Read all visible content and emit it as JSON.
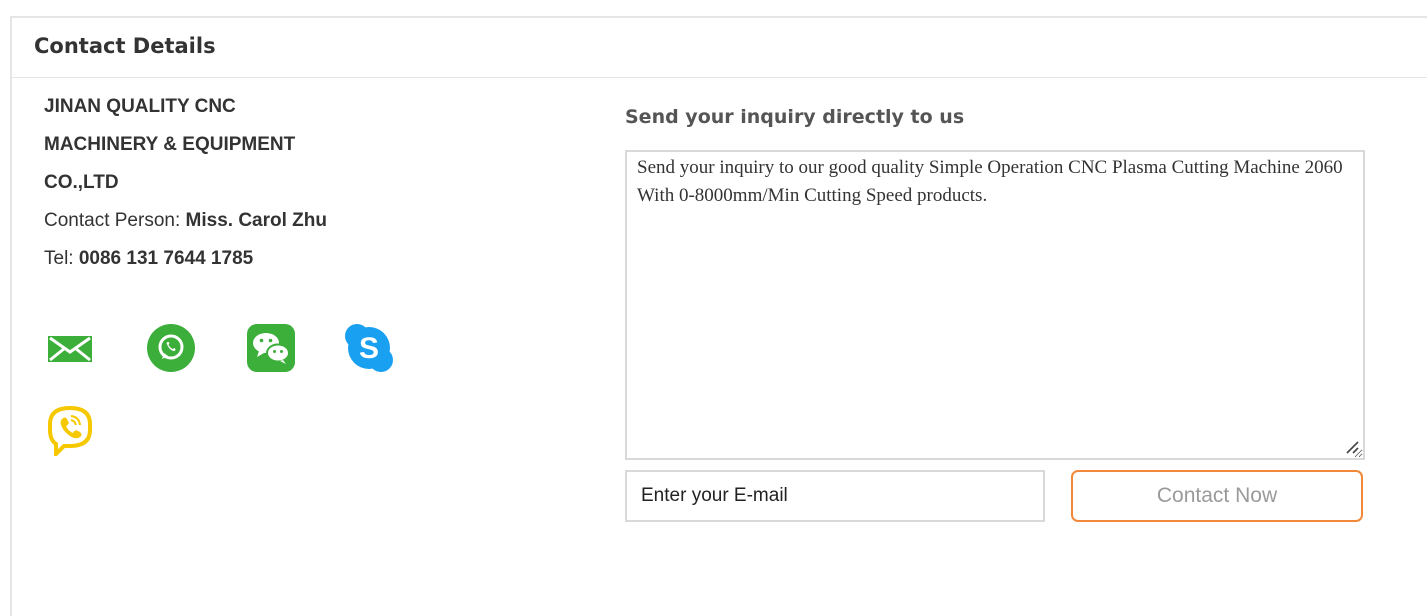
{
  "panel": {
    "title": "Contact Details"
  },
  "company": {
    "name_lines": [
      "JINAN QUALITY CNC",
      "MACHINERY & EQUIPMENT",
      "CO.,LTD"
    ],
    "contact_label": "Contact Person: ",
    "contact_name": "Miss. Carol Zhu",
    "tel_label": "Tel: ",
    "tel_value": "0086 131 7644 1785"
  },
  "icons": [
    {
      "name": "email-icon",
      "color": "#3cae3a"
    },
    {
      "name": "whatsapp-icon",
      "color": "#3cae3a"
    },
    {
      "name": "wechat-icon",
      "color": "#3cae3a"
    },
    {
      "name": "skype-icon",
      "color": "#1aa0f0"
    },
    {
      "name": "viber-icon",
      "color": "#f5c800"
    }
  ],
  "inquiry": {
    "title": "Send your inquiry directly to us",
    "message": "Send your inquiry to our good quality Simple Operation CNC Plasma Cutting Machine 2060 With 0-8000mm/Min Cutting Speed products.",
    "email_placeholder": "Enter your E-mail",
    "email_value": "",
    "submit_label": "Contact Now"
  },
  "colors": {
    "accent_border": "#f08a3a",
    "border": "#d9d9d9",
    "text": "#333333"
  }
}
